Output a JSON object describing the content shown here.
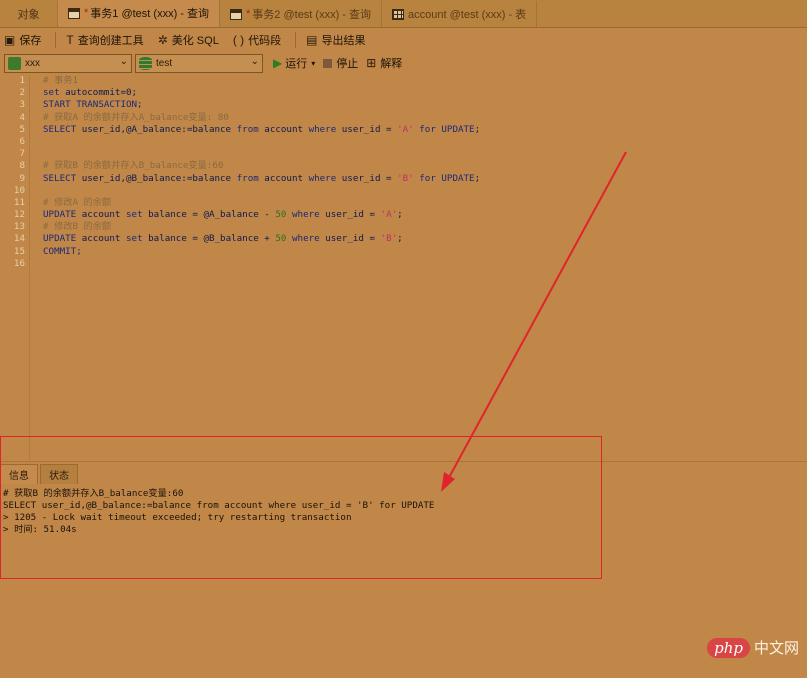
{
  "tabs": [
    {
      "label": "对象",
      "modified": false,
      "icon": ""
    },
    {
      "label": "事务1 @test (xxx) - 查询",
      "modified": true,
      "icon": "query-icon"
    },
    {
      "label": "事务2 @test (xxx) - 查询",
      "modified": true,
      "icon": "query-icon"
    },
    {
      "label": "account @test (xxx) - 表",
      "modified": false,
      "icon": "table-icon"
    }
  ],
  "toolbar": {
    "save": "保存",
    "query_builder": "查询创建工具",
    "beautify": "美化 SQL",
    "snippet": "代码段",
    "export": "导出结果"
  },
  "toolbar2": {
    "connection": "xxx",
    "database": "test",
    "run": "运行",
    "stop": "停止",
    "explain": "解释"
  },
  "editor": {
    "lines": [
      [
        [
          "cm",
          "# 事务1"
        ]
      ],
      [
        [
          "kw",
          "set"
        ],
        [
          "",
          " autocommit=0;"
        ]
      ],
      [
        [
          "kw",
          "START TRANSACTION;"
        ]
      ],
      [
        [
          "cm",
          "# 获取A 的余额并存入A_balance变量: 80"
        ]
      ],
      [
        [
          "kw",
          "SELECT"
        ],
        [
          "",
          " user_id,@A_balance:=balance "
        ],
        [
          "kw",
          "from"
        ],
        [
          "",
          " account "
        ],
        [
          "kw",
          "where"
        ],
        [
          "",
          " user_id = "
        ],
        [
          "str",
          "'A'"
        ],
        [
          "",
          " "
        ],
        [
          "kw",
          "for UPDATE"
        ],
        [
          "",
          ";"
        ]
      ],
      [],
      [],
      [
        [
          "cm",
          "# 获取B 的余额并存入B_balance变量:60"
        ]
      ],
      [
        [
          "kw",
          "SELECT"
        ],
        [
          "",
          " user_id,@B_balance:=balance "
        ],
        [
          "kw",
          "from"
        ],
        [
          "",
          " account "
        ],
        [
          "kw",
          "where"
        ],
        [
          "",
          " user_id = "
        ],
        [
          "str",
          "'B'"
        ],
        [
          "",
          " "
        ],
        [
          "kw",
          "for UPDATE"
        ],
        [
          "",
          ";"
        ]
      ],
      [],
      [
        [
          "cm",
          "# 修改A 的余额"
        ]
      ],
      [
        [
          "kw",
          "UPDATE"
        ],
        [
          "",
          " account "
        ],
        [
          "kw",
          "set"
        ],
        [
          "",
          " balance = @A_balance - "
        ],
        [
          "num",
          "50"
        ],
        [
          "",
          " "
        ],
        [
          "kw",
          "where"
        ],
        [
          "",
          " user_id = "
        ],
        [
          "str",
          "'A'"
        ],
        [
          "",
          ";"
        ]
      ],
      [
        [
          "cm",
          "# 修改B 的余额"
        ]
      ],
      [
        [
          "kw",
          "UPDATE"
        ],
        [
          "",
          " account "
        ],
        [
          "kw",
          "set"
        ],
        [
          "",
          " balance = @B_balance + "
        ],
        [
          "num",
          "50"
        ],
        [
          "",
          " "
        ],
        [
          "kw",
          "where"
        ],
        [
          "",
          " user_id = "
        ],
        [
          "str",
          "'B'"
        ],
        [
          "",
          ";"
        ]
      ],
      [
        [
          "kw",
          "COMMIT;"
        ]
      ],
      []
    ]
  },
  "panel": {
    "tab_info": "信息",
    "tab_status": "状态",
    "output": [
      "# 获取B 的余额并存入B_balance变量:60",
      "SELECT user_id,@B_balance:=balance from account where user_id = 'B' for UPDATE",
      "> 1205 - Lock wait timeout exceeded; try restarting transaction",
      "> 时间: 51.04s"
    ]
  },
  "watermark": {
    "badge": "php",
    "text": "中文网"
  },
  "colors": {
    "background": "#c08749",
    "annotation": "#e0242c"
  }
}
